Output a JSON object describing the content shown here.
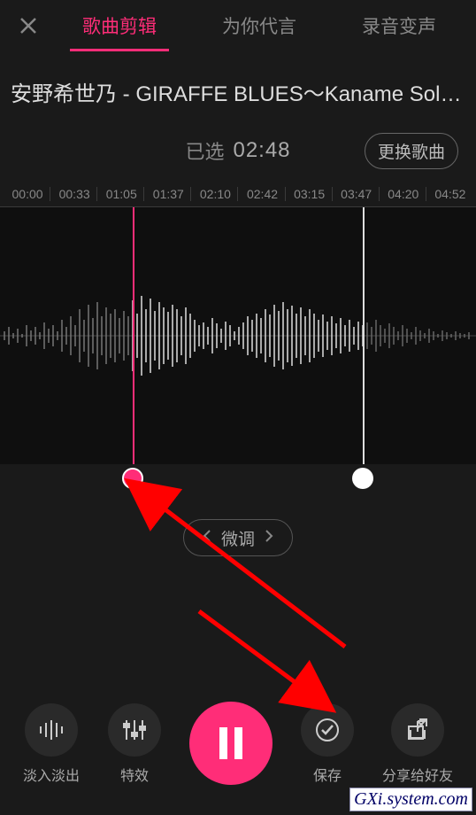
{
  "header": {
    "tabs": [
      {
        "label": "歌曲剪辑",
        "active": true
      },
      {
        "label": "为你代言",
        "active": false
      },
      {
        "label": "录音变声",
        "active": false
      }
    ]
  },
  "song": {
    "title": "安野希世乃 - GIRAFFE BLUES～Kaname Solo..."
  },
  "selection": {
    "label": "已选",
    "duration": "02:48",
    "change_button": "更换歌曲"
  },
  "timeline_ticks": [
    "00:00",
    "00:33",
    "01:05",
    "01:37",
    "02:10",
    "02:42",
    "03:15",
    "03:47",
    "04:20",
    "04:52"
  ],
  "fine_tune": {
    "label": "微调"
  },
  "toolbar": {
    "fade": "淡入淡出",
    "effects": "特效",
    "save": "保存",
    "share": "分享给好友"
  },
  "watermark": "GXi.system.com"
}
